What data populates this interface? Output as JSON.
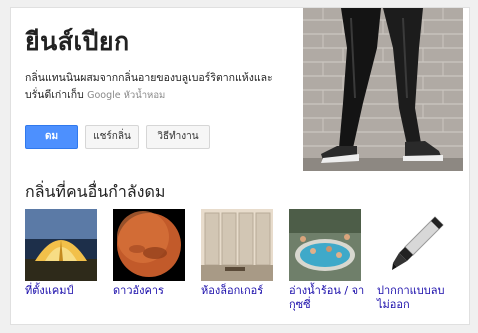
{
  "card": {
    "title": "ยีนส์เปียก",
    "description": "กลิ่นแทนนินผสมจากกลิ่นอายของบลูเบอร์ริตากแห้งและบรั่นดีเก่าเก็บ",
    "source": "Google หัวน้ำหอม",
    "buttons": [
      {
        "label": "ดม"
      },
      {
        "label": "แชร์กลิ่น"
      },
      {
        "label": "วิธีทำงาน"
      }
    ],
    "hero_image": "legs-in-wet-black-jeans-and-sneakers-against-brick-wall",
    "section_title": "กลิ่นที่คนอื่นกำลังดม",
    "related": [
      {
        "label": "ที่ตั้งแคมป์",
        "image": "tent-at-night"
      },
      {
        "label": "ดาวอังคาร",
        "image": "planet-mars"
      },
      {
        "label": "ห้องล็อกเกอร์",
        "image": "locker-room"
      },
      {
        "label": "อ่างน้ำร้อน / จากุซซี่",
        "image": "hot-tub"
      },
      {
        "label": "ปากกาแบบลบไม่ออก",
        "image": "permanent-marker"
      }
    ]
  },
  "colors": {
    "primary_button": "#4d90fe",
    "link": "#1a0dab",
    "source_text": "#888888"
  }
}
